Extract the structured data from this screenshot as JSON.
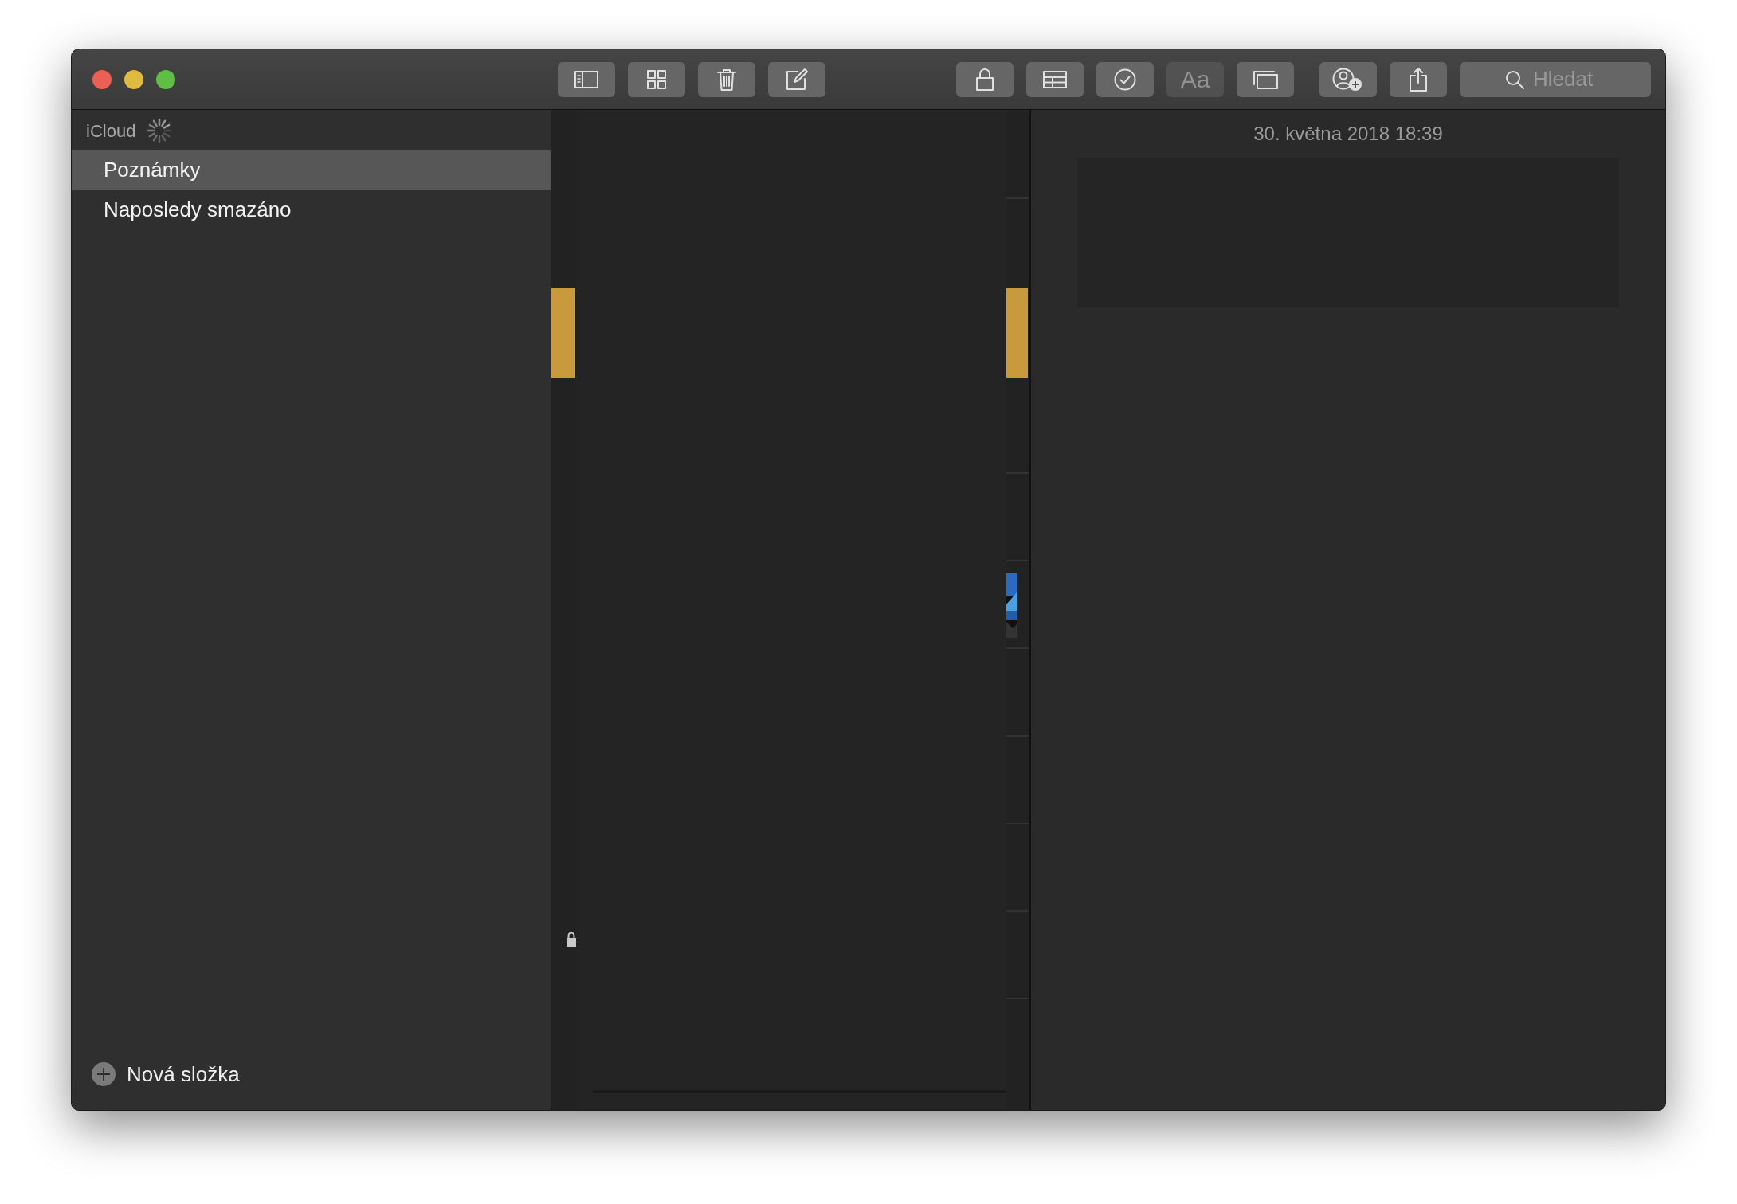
{
  "toolbar": {
    "left_buttons": [
      {
        "kind": "sidebar",
        "disabled": false
      },
      {
        "kind": "gallery",
        "disabled": false
      },
      {
        "kind": "trash",
        "disabled": false
      },
      {
        "kind": "compose",
        "disabled": false
      }
    ],
    "right_buttons": [
      {
        "kind": "lock",
        "disabled": false
      },
      {
        "kind": "table",
        "disabled": false
      },
      {
        "kind": "checklist",
        "disabled": false
      },
      {
        "kind": "text",
        "label": "Aa",
        "disabled": true
      },
      {
        "kind": "media",
        "disabled": false
      }
    ],
    "share_buttons": [
      {
        "kind": "collaborate",
        "disabled": false
      },
      {
        "kind": "share",
        "disabled": false
      }
    ],
    "search": {
      "placeholder": "Hledat"
    }
  },
  "sidebar": {
    "account": {
      "name": "iCloud",
      "syncing": true
    },
    "folders": [
      {
        "name": "Poznámky",
        "selected": true
      },
      {
        "name": "Naposledy smazáno",
        "selected": false
      }
    ],
    "new_folder": "Nová složka"
  },
  "note": {
    "date": "30. května 2018 18:39"
  }
}
